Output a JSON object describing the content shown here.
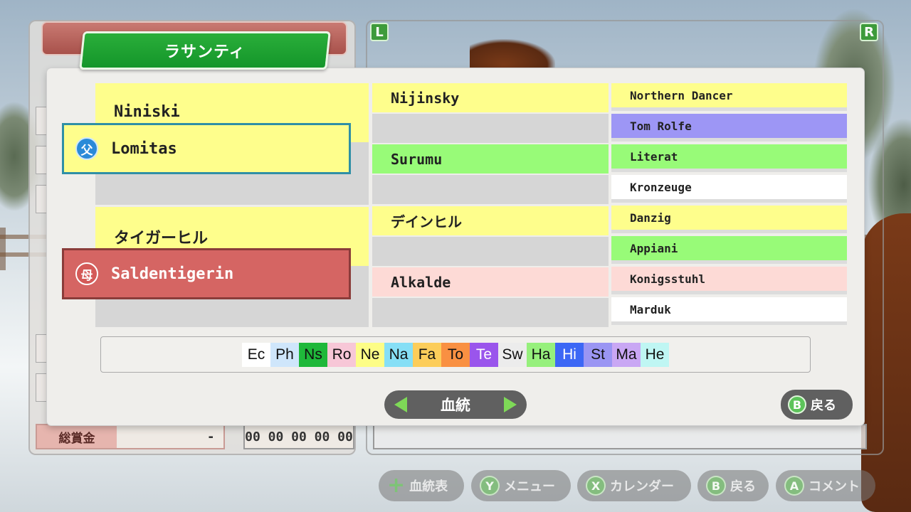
{
  "horse_name": "ラサンティ",
  "corner_badges": {
    "left": "L",
    "right": "R"
  },
  "background": {
    "prize_label": "総賞金",
    "prize_value": "-",
    "numbers": "00 00 00 00 00"
  },
  "pedigree": {
    "sire": {
      "name": "Lomitas",
      "icon": "父"
    },
    "dam": {
      "name": "Saldentigerin",
      "icon": "母"
    },
    "generation2": [
      "Niniski",
      "タイガーヒル"
    ],
    "generation3": [
      "Nijinsky",
      "Surumu",
      "デインヒル",
      "Alkalde"
    ],
    "generation4": [
      "Northern Dancer",
      "Tom Rolfe",
      "Literat",
      "Kronzeuge",
      "Danzig",
      "Appiani",
      "Konigsstuhl",
      "Marduk"
    ]
  },
  "legend": [
    {
      "code": "Ec",
      "color": "#ffffff",
      "text_color": "#111111"
    },
    {
      "code": "Ph",
      "color": "#cfe6fb",
      "text_color": "#111111"
    },
    {
      "code": "Ns",
      "color": "#1fb83a",
      "text_color": "#111111"
    },
    {
      "code": "Ro",
      "color": "#f7c7d7",
      "text_color": "#111111"
    },
    {
      "code": "Ne",
      "color": "#fdfd86",
      "text_color": "#111111"
    },
    {
      "code": "Na",
      "color": "#86dff6",
      "text_color": "#111111"
    },
    {
      "code": "Fa",
      "color": "#fccd5a",
      "text_color": "#111111"
    },
    {
      "code": "To",
      "color": "#f99042",
      "text_color": "#111111"
    },
    {
      "code": "Te",
      "color": "#9a55ec",
      "text_color": "#ffffff"
    },
    {
      "code": "Sw",
      "color": "#ececec",
      "text_color": "#111111"
    },
    {
      "code": "Ha",
      "color": "#96f07c",
      "text_color": "#111111"
    },
    {
      "code": "Hi",
      "color": "#3c67f5",
      "text_color": "#ffffff"
    },
    {
      "code": "St",
      "color": "#9a95f3",
      "text_color": "#111111"
    },
    {
      "code": "Ma",
      "color": "#c9a7f4",
      "text_color": "#111111"
    },
    {
      "code": "He",
      "color": "#bff6f3",
      "text_color": "#111111"
    }
  ],
  "nav": {
    "label": "血統",
    "back": "戻る",
    "back_button": "B"
  },
  "bottom_bar": [
    {
      "button": "+",
      "label": "血統表",
      "icon": "plus-icon"
    },
    {
      "button": "Y",
      "label": "メニュー"
    },
    {
      "button": "X",
      "label": "カレンダー"
    },
    {
      "button": "B",
      "label": "戻る"
    },
    {
      "button": "A",
      "label": "コメント"
    }
  ]
}
